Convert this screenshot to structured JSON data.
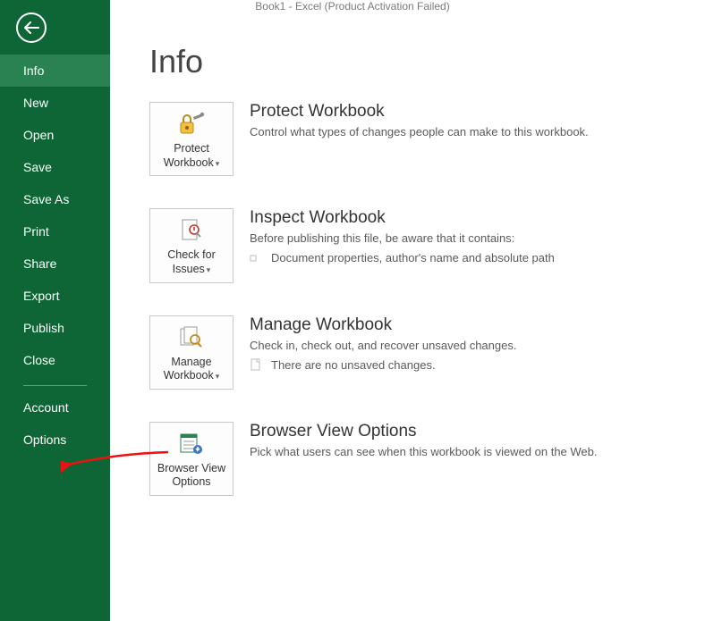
{
  "titlebar": "Book1 - Excel (Product Activation Failed)",
  "sidebar": {
    "items": [
      {
        "label": "Info",
        "selected": true
      },
      {
        "label": "New"
      },
      {
        "label": "Open"
      },
      {
        "label": "Save"
      },
      {
        "label": "Save As"
      },
      {
        "label": "Print"
      },
      {
        "label": "Share"
      },
      {
        "label": "Export"
      },
      {
        "label": "Publish"
      },
      {
        "label": "Close"
      }
    ],
    "footer": [
      {
        "label": "Account"
      },
      {
        "label": "Options"
      }
    ]
  },
  "page": {
    "title": "Info",
    "sections": {
      "protect": {
        "button": "Protect Workbook",
        "heading": "Protect Workbook",
        "desc": "Control what types of changes people can make to this workbook."
      },
      "inspect": {
        "button": "Check for Issues",
        "heading": "Inspect Workbook",
        "desc": "Before publishing this file, be aware that it contains:",
        "bullet1": "Document properties, author's name and absolute path"
      },
      "manage": {
        "button": "Manage Workbook",
        "heading": "Manage Workbook",
        "desc": "Check in, check out, and recover unsaved changes.",
        "bullet1": "There are no unsaved changes."
      },
      "browser": {
        "button": "Browser View Options",
        "heading": "Browser View Options",
        "desc": "Pick what users can see when this workbook is viewed on the Web."
      }
    }
  }
}
